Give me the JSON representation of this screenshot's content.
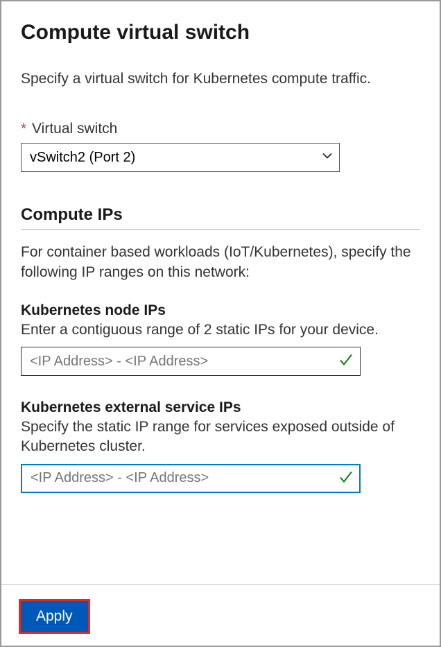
{
  "title": "Compute virtual switch",
  "description": "Specify a virtual switch for Kubernetes compute traffic.",
  "virtualSwitch": {
    "label": "Virtual switch",
    "value": "vSwitch2 (Port 2)"
  },
  "computeIPs": {
    "heading": "Compute IPs",
    "text": "For container based workloads (IoT/Kubernetes), specify the following IP ranges on this network:"
  },
  "nodeIPs": {
    "label": "Kubernetes node IPs",
    "desc": "Enter a contiguous range of 2 static IPs for your device.",
    "placeholder": "<IP Address> - <IP Address>"
  },
  "serviceIPs": {
    "label": "Kubernetes external service IPs",
    "desc": "Specify the static IP range for services exposed outside of Kubernetes cluster.",
    "placeholder": "<IP Address> - <IP Address>"
  },
  "applyLabel": "Apply"
}
